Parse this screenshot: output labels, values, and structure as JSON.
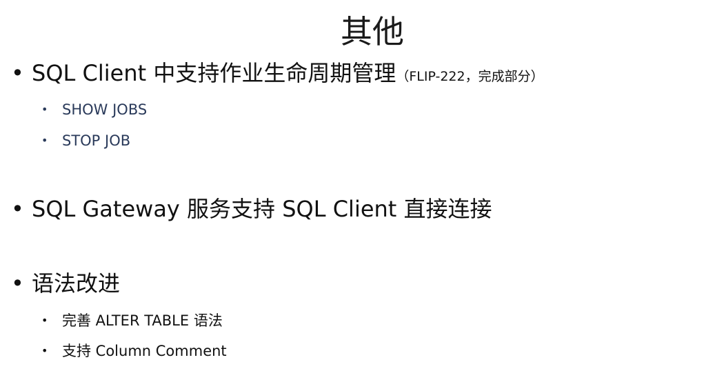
{
  "slide": {
    "title": "其他",
    "bullets": [
      {
        "text": "SQL Client 中支持作业生命周期管理",
        "note": "（FLIP-222，完成部分）",
        "subs": [
          "SHOW JOBS",
          "STOP JOB"
        ]
      },
      {
        "text": "SQL Gateway 服务支持 SQL Client 直接连接"
      },
      {
        "text": "语法改进",
        "subs": [
          "完善 ALTER TABLE 语法",
          "支持 Column Comment"
        ]
      }
    ]
  }
}
